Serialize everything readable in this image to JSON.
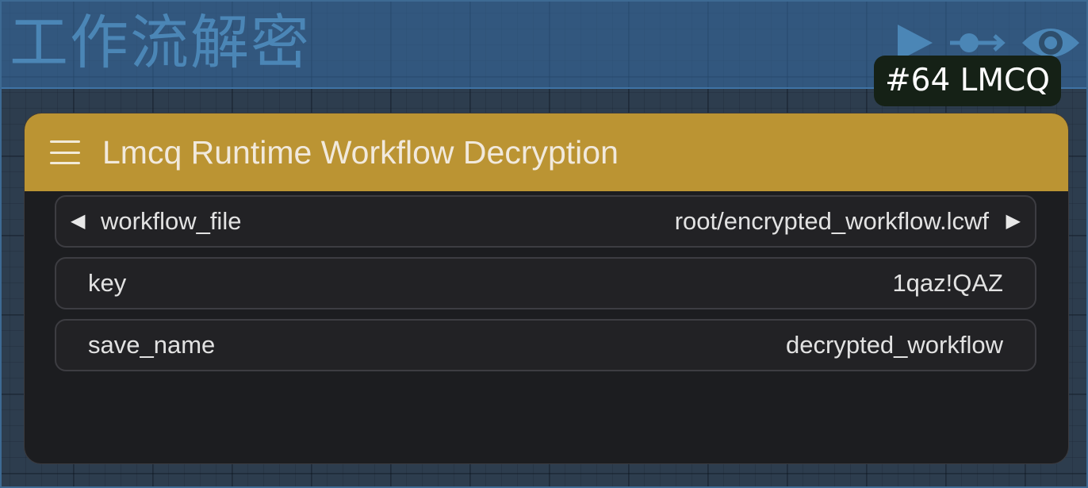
{
  "group": {
    "title": "工作流解密"
  },
  "execution_icons": [
    "play-icon",
    "connection-icon",
    "eye-icon"
  ],
  "node_id_badge": "#64 LMCQ",
  "node": {
    "title": "Lmcq Runtime Workflow Decryption",
    "header_color": "#bb9433",
    "widgets": [
      {
        "label": "workflow_file",
        "value": "root/encrypted_workflow.lcwf",
        "type": "combo"
      },
      {
        "label": "key",
        "value": "1qaz!QAZ",
        "type": "text"
      },
      {
        "label": "save_name",
        "value": "decrypted_workflow",
        "type": "text"
      }
    ]
  }
}
